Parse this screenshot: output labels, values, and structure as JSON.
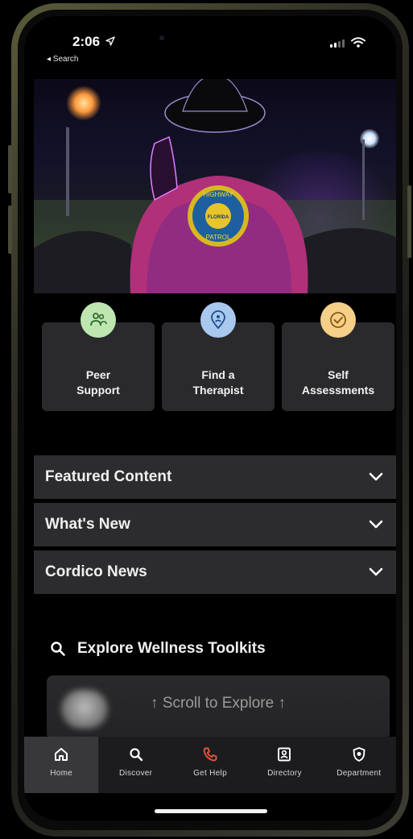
{
  "status_bar": {
    "time": "2:06",
    "back_label": "◂ Search"
  },
  "quick_actions": [
    {
      "label_line1": "Peer",
      "label_line2": "Support",
      "icon": "peer-support-icon",
      "color": "#bfe6b0"
    },
    {
      "label_line1": "Find a",
      "label_line2": "Therapist",
      "icon": "location-pin-icon",
      "color": "#a9c8ee"
    },
    {
      "label_line1": "Self",
      "label_line2": "Assessments",
      "icon": "check-circle-icon",
      "color": "#f6cf88"
    }
  ],
  "sections": [
    {
      "title": "Featured Content"
    },
    {
      "title": "What's New"
    },
    {
      "title": "Cordico News"
    }
  ],
  "explore": {
    "title": "Explore Wellness Toolkits",
    "scroll_hint": "↑ Scroll to Explore ↑"
  },
  "hero": {
    "badge_top": "HIGHWAY",
    "badge_middle": "FLORIDA",
    "badge_bottom": "PATROL"
  },
  "tabs": [
    {
      "label": "Home",
      "icon": "home-icon",
      "active": true
    },
    {
      "label": "Discover",
      "icon": "search-icon"
    },
    {
      "label": "Get Help",
      "icon": "phone-icon",
      "accent": "#e2553d"
    },
    {
      "label": "Directory",
      "icon": "contact-card-icon"
    },
    {
      "label": "Department",
      "icon": "badge-shield-icon"
    }
  ]
}
